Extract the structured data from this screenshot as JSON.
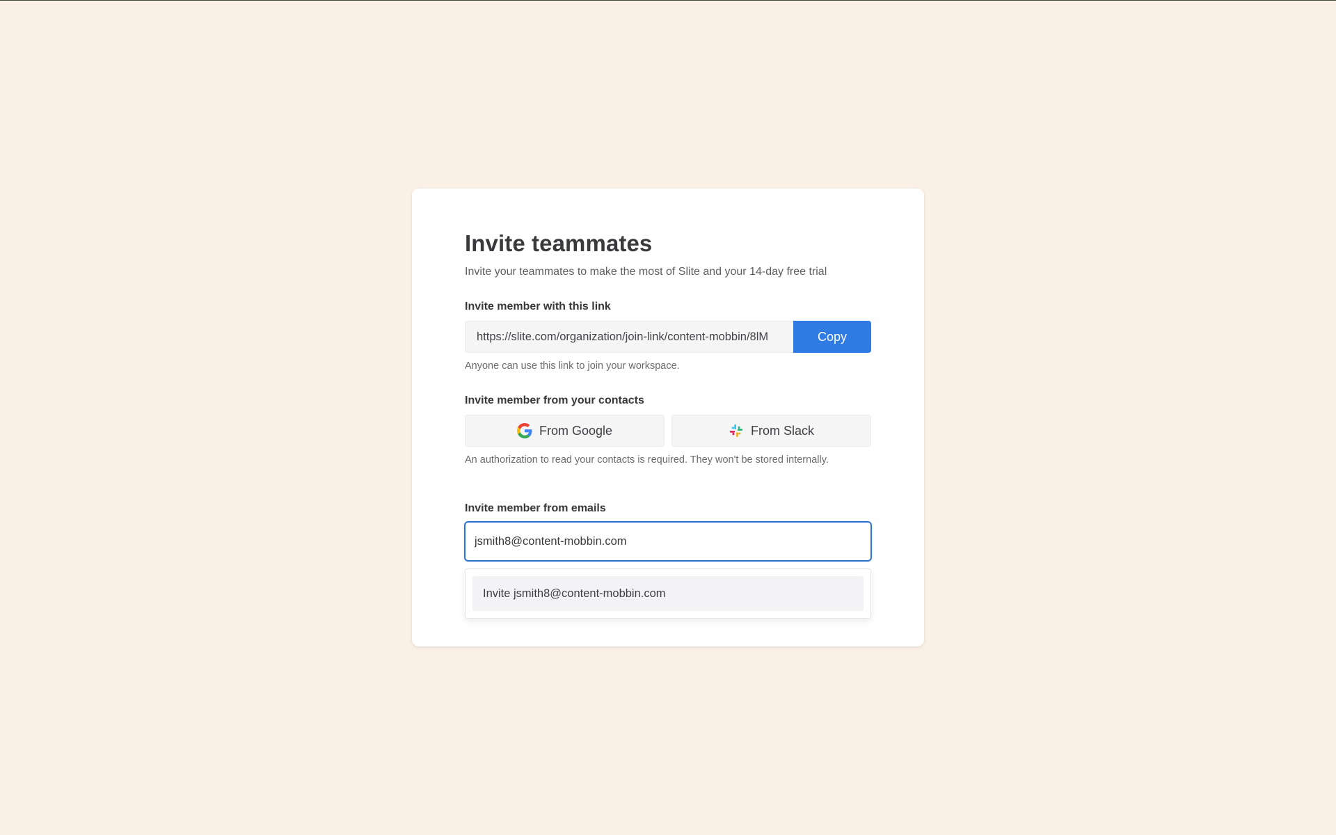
{
  "invite": {
    "title": "Invite teammates",
    "subtitle": "Invite your teammates to make the most of Slite and your 14-day free trial",
    "link_section": {
      "label": "Invite member with this link",
      "url": "https://slite.com/organization/join-link/content-mobbin/8lM",
      "copy_label": "Copy",
      "helper": "Anyone can use this link to join your workspace."
    },
    "contacts_section": {
      "label": "Invite member from your contacts",
      "google_label": "From Google",
      "slack_label": "From Slack",
      "helper": "An authorization to read your contacts is required. They won't be stored internally."
    },
    "emails_section": {
      "label": "Invite member from emails",
      "input_value": "jsmith8@content-mobbin.com",
      "suggestion": "Invite jsmith8@content-mobbin.com"
    }
  },
  "colors": {
    "background": "#faf0e6",
    "primary": "#2e7be3",
    "focus_border": "#2f73d0"
  },
  "icons": {
    "google": "google-icon",
    "slack": "slack-icon"
  }
}
